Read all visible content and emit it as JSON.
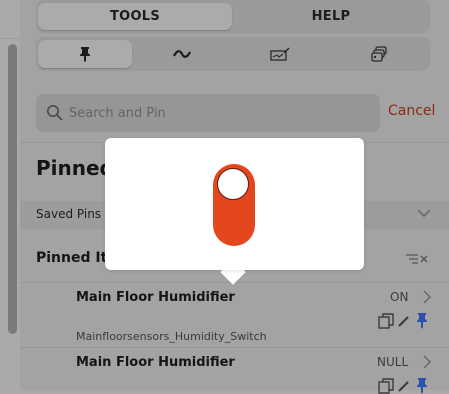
{
  "top_tabs": [
    {
      "label": "TOOLS",
      "active": true
    },
    {
      "label": "HELP",
      "active": false
    }
  ],
  "tool_tabs": [
    {
      "icon": "pin-icon",
      "active": true
    },
    {
      "icon": "wave-icon",
      "active": false
    },
    {
      "icon": "signature-icon",
      "active": false
    },
    {
      "icon": "stacked-devices-icon",
      "active": false
    }
  ],
  "search": {
    "placeholder": "Search and Pin",
    "value": "",
    "cancel_label": "Cancel"
  },
  "pinned_heading": "Pinned",
  "saved_pins": {
    "label": "Saved Pins"
  },
  "pinned_items": {
    "label": "Pinned Ite",
    "items": [
      {
        "title": "Main Floor Humidifier",
        "state": "ON",
        "subtitle": "Mainfloorsensors_Humidity_Switch"
      },
      {
        "title": "Main Floor Humidifier",
        "state": "NULL",
        "subtitle": ""
      }
    ]
  },
  "popover": {
    "toggle": {
      "state": "on",
      "color": "#e4461e"
    }
  },
  "colors": {
    "accent": "#e4461e",
    "cancel_text": "#8a2b14",
    "pin_blue": "#2c4fb0"
  }
}
